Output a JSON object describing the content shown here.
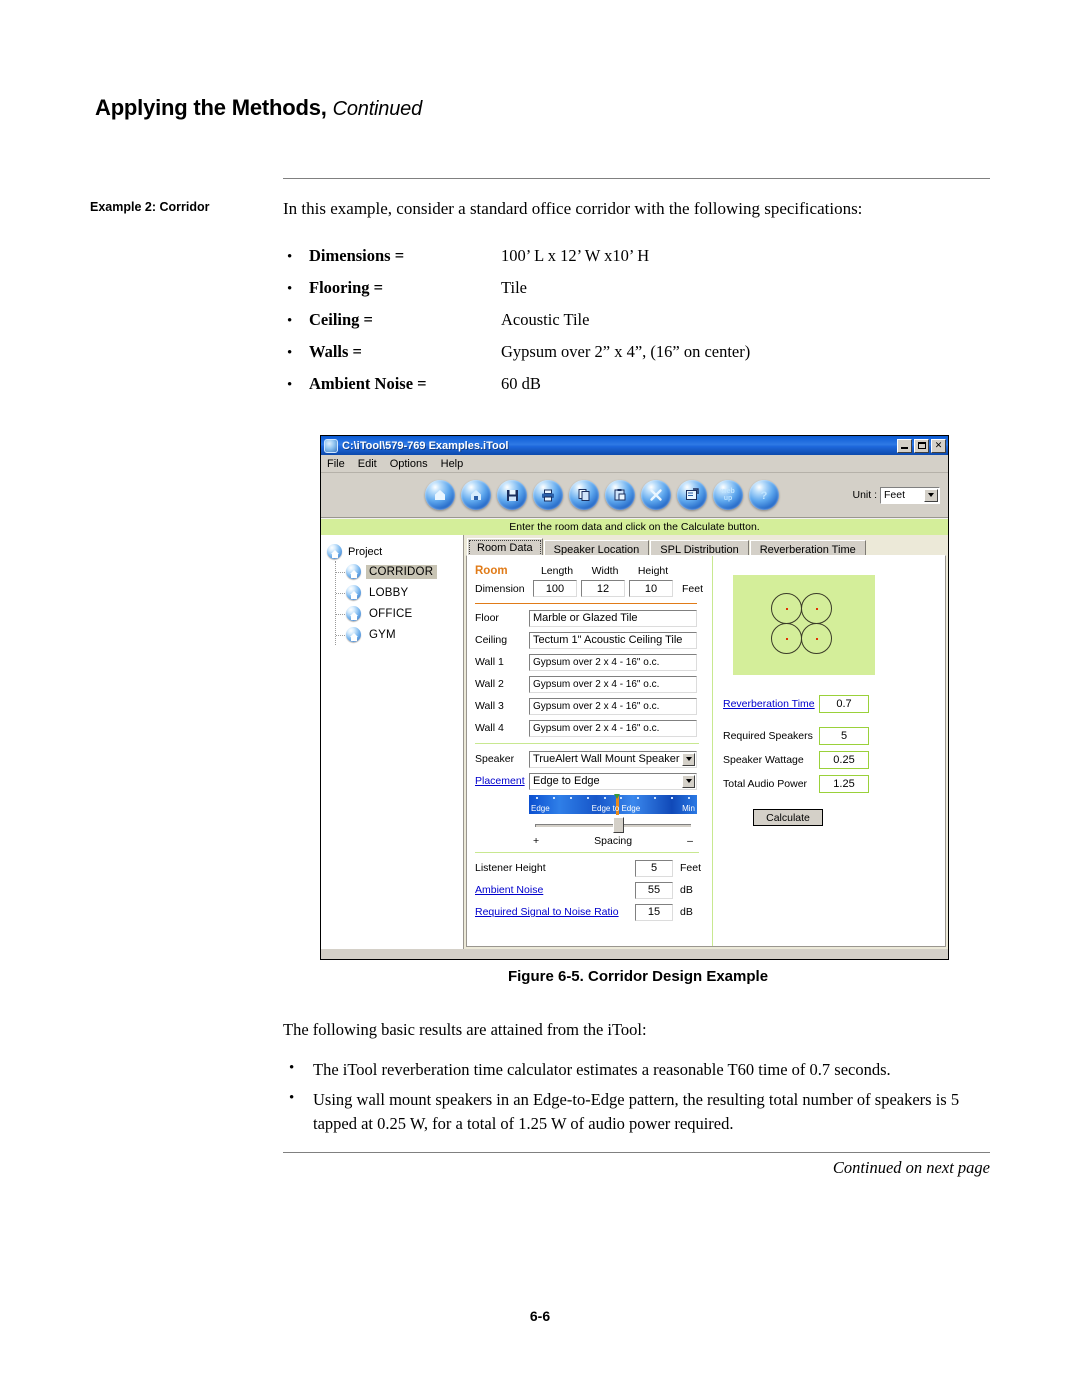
{
  "header": {
    "title_main": "Applying the Methods,",
    "title_continued": "Continued",
    "side_label": "Example 2: Corridor",
    "intro": "In this example, consider a standard office corridor with the following specifications:"
  },
  "specs": [
    {
      "bullet": "•",
      "term": "Dimensions =",
      "value": "100’ L x 12’ W x10’ H"
    },
    {
      "bullet": "•",
      "term": "Flooring =",
      "value": "Tile"
    },
    {
      "bullet": "•",
      "term": "Ceiling =",
      "value": "Acoustic Tile"
    },
    {
      "bullet": "•",
      "term": "Walls =",
      "value": "Gypsum over 2” x 4”, (16” on center)"
    },
    {
      "bullet": "•",
      "term": "Ambient Noise =",
      "value": "60 dB"
    }
  ],
  "app": {
    "title": "C:\\iTool\\579-769 Examples.iTool",
    "window_buttons": {
      "minimize": "minimize-button",
      "maximize": "maximize-button",
      "close": "✕"
    },
    "menus": [
      "File",
      "Edit",
      "Options",
      "Help"
    ],
    "toolbar_icons": [
      "new-project-icon",
      "open-project-icon",
      "save-icon",
      "print-icon",
      "copy-icon",
      "paste-icon",
      "delete-icon",
      "properties-icon",
      "web-update-icon",
      "help-icon"
    ],
    "toolbar_web_line1": "web",
    "toolbar_web_line2": "up",
    "unit_label": "Unit :",
    "unit_value": "Feet",
    "hint": "Enter the room data and click on the Calculate button.",
    "tree": {
      "root": "Project",
      "nodes": [
        {
          "label": "CORRIDOR",
          "selected": true
        },
        {
          "label": "LOBBY",
          "selected": false
        },
        {
          "label": "OFFICE",
          "selected": false
        },
        {
          "label": "GYM",
          "selected": false
        }
      ]
    },
    "tabs": [
      {
        "label": "Room Data",
        "active": true
      },
      {
        "label": "Speaker Location",
        "active": false
      },
      {
        "label": "SPL Distribution",
        "active": false
      },
      {
        "label": "Reverberation Time",
        "active": false
      }
    ],
    "room": {
      "group_label": "Room",
      "dimension_label": "Dimension",
      "col_length": "Length",
      "col_width": "Width",
      "col_height": "Height",
      "length": "100",
      "width": "12",
      "height": "10",
      "unit": "Feet"
    },
    "materials": [
      {
        "label": "Floor",
        "value": "Marble or Glazed Tile"
      },
      {
        "label": "Ceiling",
        "value": "Tectum 1\" Acoustic Ceiling Tile"
      },
      {
        "label": "Wall 1",
        "value": "Gypsum over 2 x 4 - 16\" o.c."
      },
      {
        "label": "Wall 2",
        "value": "Gypsum over 2 x 4 - 16\" o.c."
      },
      {
        "label": "Wall 3",
        "value": "Gypsum over 2 x 4 - 16\" o.c."
      },
      {
        "label": "Wall 4",
        "value": "Gypsum over 2 x 4 - 16\" o.c."
      }
    ],
    "speaker": {
      "speaker_label": "Speaker",
      "speaker_value": "TrueAlert Wall Mount Speaker w/S",
      "placement_label": "Placement",
      "placement_value": "Edge to Edge",
      "bar_left": "Edge",
      "bar_mid": "Edge to Edge",
      "bar_right": "Min",
      "slider_plus": "+",
      "slider_minus": "–",
      "slider_label": "Spacing"
    },
    "acoustics": [
      {
        "label": "Listener Height",
        "value": "5",
        "unit": "Feet",
        "link": false
      },
      {
        "label": "Ambient Noise",
        "value": "55",
        "unit": "dB",
        "link": true
      },
      {
        "label": "Required Signal to Noise Ratio",
        "value": "15",
        "unit": "dB",
        "link": true
      }
    ],
    "results": [
      {
        "label": "Reverberation Time",
        "value": "0.7",
        "link": true
      },
      {
        "label": "Required Speakers",
        "value": "5",
        "link": false
      },
      {
        "label": "Speaker Wattage",
        "value": "0.25",
        "link": false
      },
      {
        "label": "Total Audio Power",
        "value": "1.25",
        "link": false
      }
    ],
    "calculate_label": "Calculate"
  },
  "figure": {
    "caption": "Figure 6-5.  Corridor Design Example"
  },
  "results_text": {
    "intro": "The following basic results are attained from the iTool:",
    "items": [
      {
        "bullet": "•",
        "text": "The iTool reverberation time calculator estimates a reasonable T60 time of 0.7 seconds."
      },
      {
        "bullet": "•",
        "text": "Using wall mount speakers in an Edge-to-Edge pattern, the resulting total number of speakers is 5 tapped at 0.25 W, for a total of 1.25 W of audio power required."
      }
    ]
  },
  "footer": {
    "continued": "Continued on next page",
    "page_number": "6-6"
  },
  "colors": {
    "titlebar_blue": "#0a5ad4",
    "hint_green": "#d4ee9a",
    "orange_accent": "#e07b18",
    "result_border_green": "#9ad13a",
    "link_blue": "#0000cc"
  }
}
